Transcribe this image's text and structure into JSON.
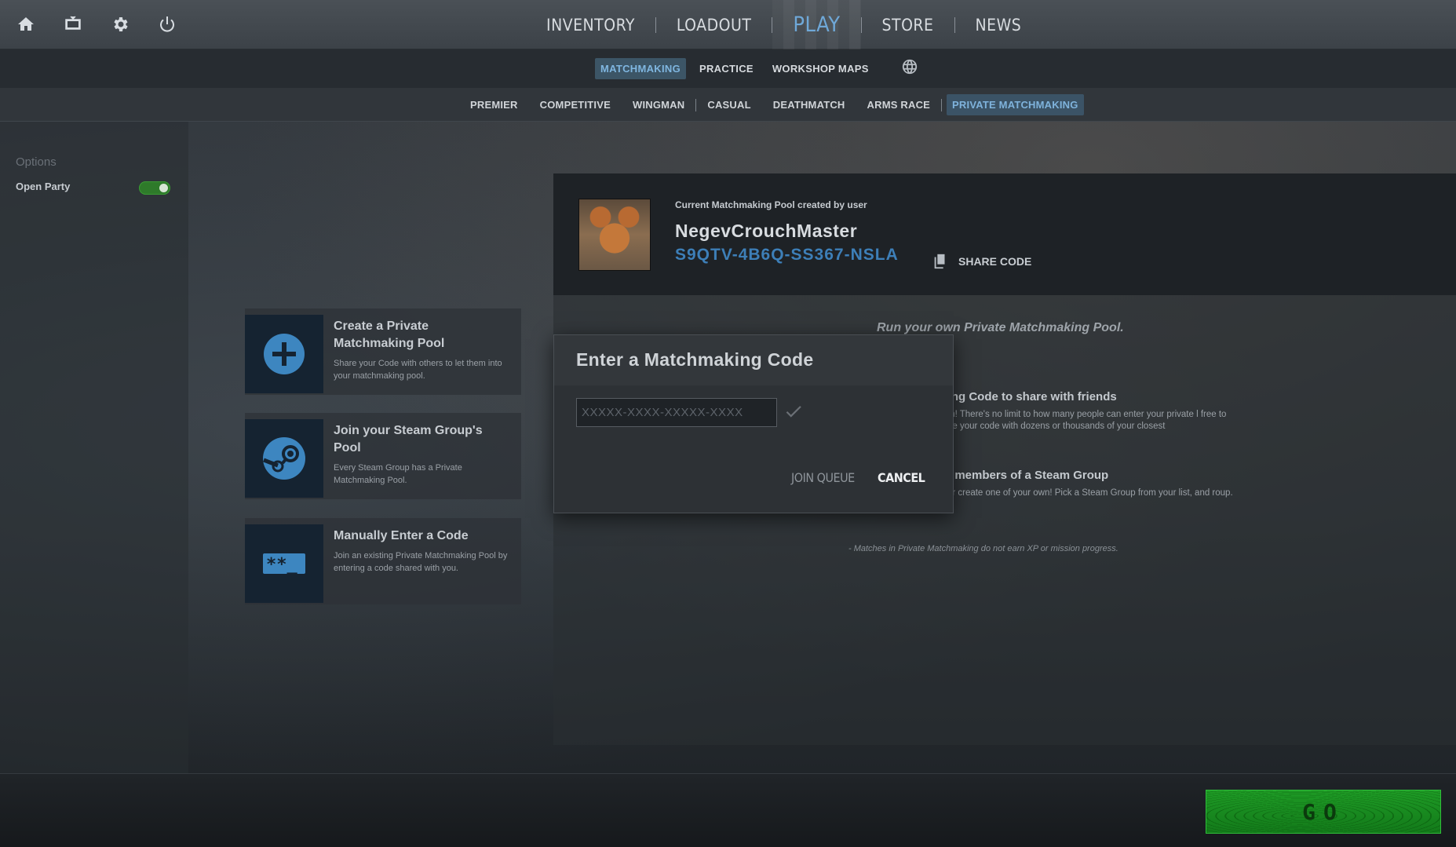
{
  "topnav": {
    "icons": [
      "home-icon",
      "tv-icon",
      "gear-icon",
      "power-icon"
    ],
    "items": [
      {
        "label": "INVENTORY"
      },
      {
        "label": "LOADOUT"
      },
      {
        "label": "PLAY",
        "active": true
      },
      {
        "label": "STORE"
      },
      {
        "label": "NEWS"
      }
    ]
  },
  "subnav": {
    "items": [
      {
        "label": "MATCHMAKING",
        "active": true
      },
      {
        "label": "PRACTICE"
      },
      {
        "label": "WORKSHOP MAPS"
      }
    ],
    "globe_icon": "globe-icon"
  },
  "modes": {
    "items": [
      {
        "label": "PREMIER"
      },
      {
        "label": "COMPETITIVE"
      },
      {
        "label": "WINGMAN"
      },
      {
        "label": "CASUAL"
      },
      {
        "label": "DEATHMATCH"
      },
      {
        "label": "ARMS RACE"
      },
      {
        "label": "PRIVATE MATCHMAKING",
        "active": true
      }
    ]
  },
  "options": {
    "title": "Options",
    "open_party_label": "Open Party",
    "open_party_on": true
  },
  "cards": [
    {
      "title": "Create a Private Matchmaking Pool",
      "desc": "Share your Code with others to let them into your matchmaking pool.",
      "icon": "plus-icon"
    },
    {
      "title": "Join your Steam Group's Pool",
      "desc": "Every Steam Group has a Private Matchmaking Pool.",
      "icon": "steam-icon"
    },
    {
      "title": "Manually Enter a Code",
      "desc": "Join an existing Private Matchmaking Pool by entering a code shared with you.",
      "icon": "code-entry-icon"
    }
  ],
  "pool": {
    "label": "Current Matchmaking Pool created by user",
    "username": "NegevCrouchMaster",
    "code": "S9QTV-4B6Q-SS367-NSLA",
    "share_label": "SHARE CODE"
  },
  "info": {
    "run_title": "Run your own Private Matchmaking Pool.",
    "section1_title": "aking Code to share with friends",
    "section1_desc": "team! There's no limit to how many people can enter your private l free to share your code with dozens or thousands of your closest",
    "section2_title": "th members of a Steam Group",
    "section2_desc": "y or create one of your own! Pick a Steam Group from your list, and roup.",
    "note": "- Matches in Private Matchmaking do not earn XP or mission progress."
  },
  "modal": {
    "title": "Enter a Matchmaking Code",
    "input_value": "",
    "input_placeholder": "XXXXX-XXXX-XXXXX-XXXX",
    "join_label": "JOIN QUEUE",
    "cancel_label": "CANCEL"
  },
  "go": {
    "label": "GO"
  },
  "colors": {
    "accent_blue": "#3d7fb8",
    "go_green": "#1e9a25",
    "toggle_green": "#2e7a2a"
  }
}
